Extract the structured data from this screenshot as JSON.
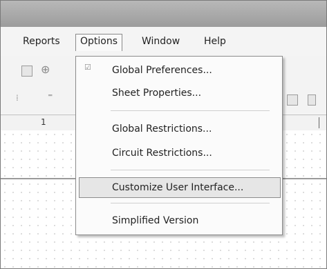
{
  "menubar": {
    "reports": "Reports",
    "options": "Options",
    "window": "Window",
    "help": "Help"
  },
  "ruler": {
    "num1": "1"
  },
  "dropdown": {
    "items": [
      {
        "label": "Global Preferences...",
        "icon": "checkmark-icon"
      },
      {
        "label": "Sheet Properties..."
      },
      {
        "label": "Global Restrictions..."
      },
      {
        "label": "Circuit Restrictions..."
      },
      {
        "label": "Customize User Interface..."
      },
      {
        "label": "Simplified Version"
      }
    ]
  }
}
